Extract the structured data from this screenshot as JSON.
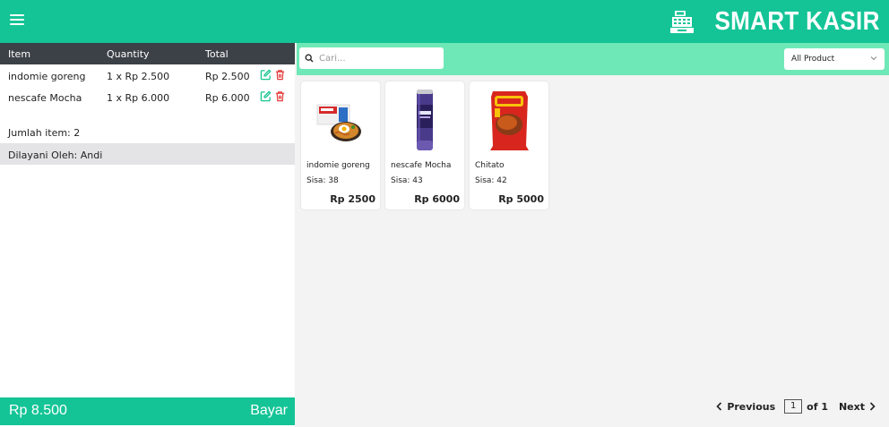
{
  "header": {
    "brand": "SMART KASIR",
    "menu_icon": "hamburger-icon",
    "logo_icon": "cash-register-icon",
    "color": "#14c496"
  },
  "cart": {
    "columns": [
      "Item",
      "Quantity",
      "Total"
    ],
    "rows": [
      {
        "item": "indomie goreng",
        "quantity": "1 x Rp 2.500",
        "total": "Rp 2.500"
      },
      {
        "item": "nescafe Mocha",
        "quantity": "1 x Rp 6.000",
        "total": "Rp 6.000"
      }
    ],
    "edit_icon": "edit-icon",
    "delete_icon": "trash-icon",
    "item_count": "Jumlah item: 2",
    "served_by": "Dilayani Oleh: Andi",
    "grand_total": "Rp 8.500",
    "pay_label": "Bayar"
  },
  "catalog": {
    "search": {
      "placeholder": "Cari...",
      "value": "",
      "icon": "search-icon"
    },
    "filter": {
      "selected": "All Product"
    },
    "products": [
      {
        "name": "indomie goreng",
        "stock": "Sisa: 38",
        "price": "Rp 2500"
      },
      {
        "name": "nescafe Mocha",
        "stock": "Sisa: 43",
        "price": "Rp 6000"
      },
      {
        "name": "Chitato",
        "stock": "Sisa: 42",
        "price": "Rp 5000"
      }
    ],
    "pagination": {
      "previous": "Previous",
      "page": "1",
      "of": "of 1",
      "next": "Next"
    }
  }
}
